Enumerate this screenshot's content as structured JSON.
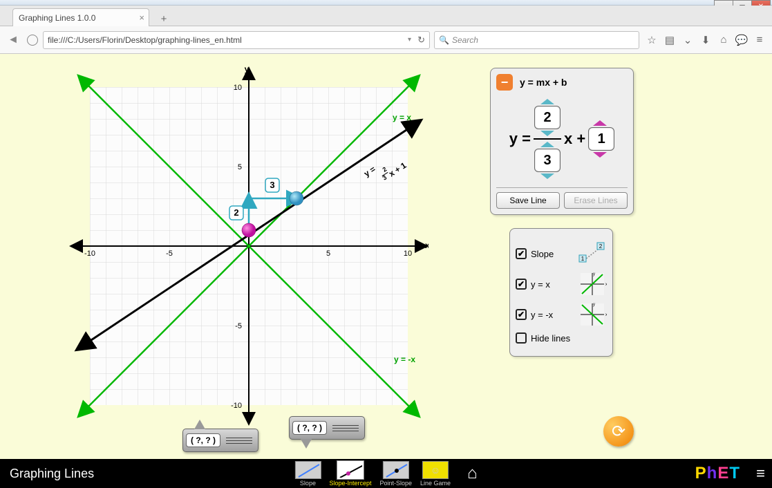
{
  "window": {
    "title": "Graphing Lines 1.0.0"
  },
  "browser": {
    "url": "file:///C:/Users/Florin/Desktop/graphing-lines_en.html",
    "search_placeholder": "Search"
  },
  "graph": {
    "x_label": "x",
    "y_label": "y",
    "xmin": -10,
    "xmax": 10,
    "ymin": -10,
    "ymax": 10,
    "ticks": [
      -10,
      -5,
      5,
      10
    ],
    "ref_lines": [
      {
        "label": "y = x",
        "slope": 1,
        "intercept": 0
      },
      {
        "label": "y = -x",
        "slope": -1,
        "intercept": 0
      }
    ],
    "main_line": {
      "rise": 2,
      "run": 3,
      "intercept": 1,
      "equation_label": "y = ⅔x + 1"
    },
    "rise_badge": "2",
    "run_badge": "3"
  },
  "equation_panel": {
    "minus": "−",
    "form_label": "y = mx + b",
    "y_eq": "y =",
    "numerator": "2",
    "denominator": "3",
    "x_plus": "x +",
    "intercept": "1",
    "save_label": "Save Line",
    "erase_label": "Erase Lines"
  },
  "options": {
    "slope": {
      "label": "Slope",
      "checked": true
    },
    "yx": {
      "label": "y = x",
      "checked": true
    },
    "ynx": {
      "label": "y = -x",
      "checked": true
    },
    "hide": {
      "label": "Hide lines",
      "checked": false
    }
  },
  "point_tools": {
    "p1": "( ?, ? )",
    "p2": "( ?, ? )"
  },
  "bottom_nav": {
    "title": "Graphing Lines",
    "items": [
      "Slope",
      "Slope-Intercept",
      "Point-Slope",
      "Line Game"
    ],
    "active_index": 1,
    "logo": "PhET"
  },
  "chart_data": {
    "type": "line",
    "title": "Graphing Lines — Slope-Intercept",
    "xlabel": "x",
    "ylabel": "y",
    "xlim": [
      -10,
      10
    ],
    "ylim": [
      -10,
      10
    ],
    "series": [
      {
        "name": "y = x",
        "slope": 1,
        "intercept": 0
      },
      {
        "name": "y = -x",
        "slope": -1,
        "intercept": 0
      },
      {
        "name": "y = (2/3)x + 1",
        "slope": 0.6667,
        "intercept": 1
      }
    ],
    "points": [
      {
        "name": "y-intercept",
        "x": 0,
        "y": 1
      },
      {
        "name": "slope-handle",
        "x": 3,
        "y": 3
      }
    ],
    "slope_triangle": {
      "rise": 2,
      "run": 3
    }
  }
}
